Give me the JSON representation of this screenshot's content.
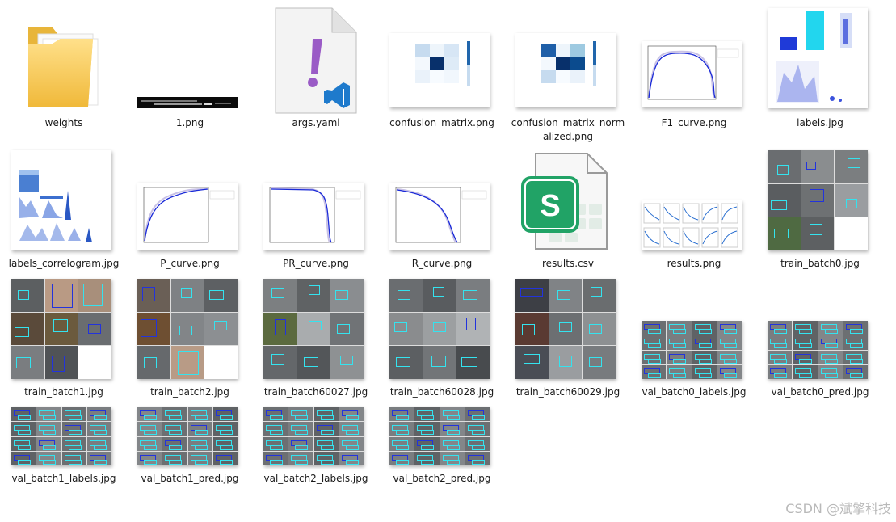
{
  "files": [
    {
      "name": "weights",
      "kind": "folder"
    },
    {
      "name": "1.png",
      "kind": "terminal"
    },
    {
      "name": "args.yaml",
      "kind": "yaml"
    },
    {
      "name": "confusion_matrix.png",
      "kind": "matrix"
    },
    {
      "name": "confusion_matrix_normalized.png",
      "kind": "matrix"
    },
    {
      "name": "F1_curve.png",
      "kind": "curve"
    },
    {
      "name": "labels.jpg",
      "kind": "labels"
    },
    {
      "name": "labels_correlogram.jpg",
      "kind": "correlogram"
    },
    {
      "name": "P_curve.png",
      "kind": "curve"
    },
    {
      "name": "PR_curve.png",
      "kind": "curve"
    },
    {
      "name": "R_curve.png",
      "kind": "curve"
    },
    {
      "name": "results.csv",
      "kind": "csv"
    },
    {
      "name": "results.png",
      "kind": "results"
    },
    {
      "name": "train_batch0.jpg",
      "kind": "batch"
    },
    {
      "name": "train_batch1.jpg",
      "kind": "batch"
    },
    {
      "name": "train_batch2.jpg",
      "kind": "batch"
    },
    {
      "name": "train_batch60027.jpg",
      "kind": "batch"
    },
    {
      "name": "train_batch60028.jpg",
      "kind": "batch"
    },
    {
      "name": "train_batch60029.jpg",
      "kind": "batch"
    },
    {
      "name": "val_batch0_labels.jpg",
      "kind": "val"
    },
    {
      "name": "val_batch0_pred.jpg",
      "kind": "val"
    },
    {
      "name": "val_batch1_labels.jpg",
      "kind": "val"
    },
    {
      "name": "val_batch1_pred.jpg",
      "kind": "val"
    },
    {
      "name": "val_batch2_labels.jpg",
      "kind": "val"
    },
    {
      "name": "val_batch2_pred.jpg",
      "kind": "val"
    }
  ],
  "labels_display": {
    "confusion_matrix_normalized": [
      "confusion_matrix_norm",
      "alized.png"
    ]
  },
  "watermark": "CSDN @斌擎科技",
  "icons": {
    "folder": "folder-icon",
    "yaml": "vscode-yaml-icon",
    "csv": "spreadsheet-csv-icon"
  },
  "colors": {
    "folder": "#f4c542",
    "vscode": "#1e7acc",
    "excel_green": "#21a366",
    "exclaim_purple": "#9a5bc6",
    "box_cyan": "#34e3ef",
    "box_blue": "#2233dd"
  }
}
